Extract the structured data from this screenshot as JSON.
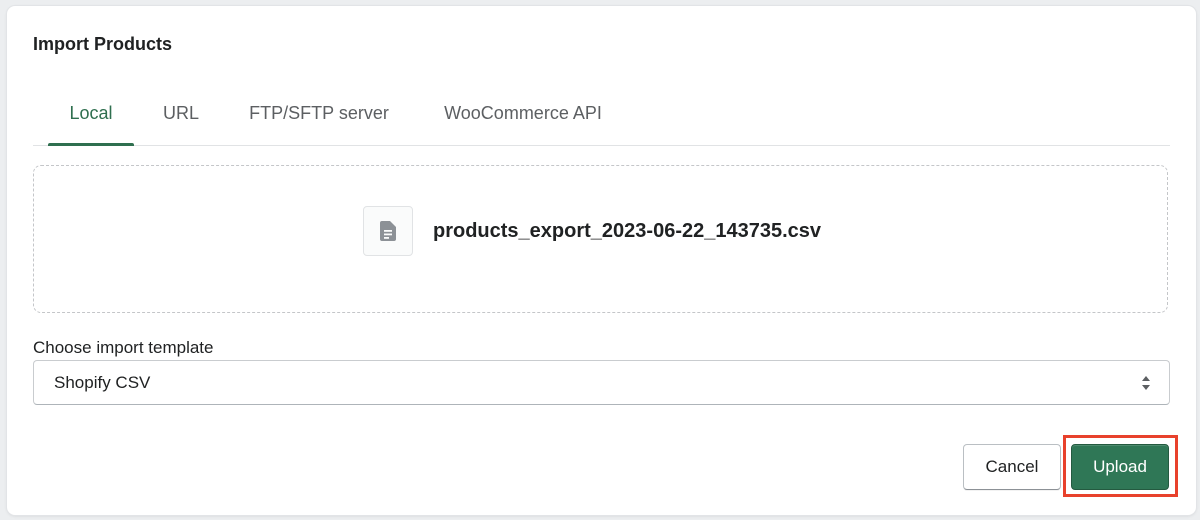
{
  "dialog": {
    "title": "Import Products"
  },
  "tabs": [
    {
      "label": "Local",
      "active": true
    },
    {
      "label": "URL",
      "active": false
    },
    {
      "label": "FTP/SFTP server",
      "active": false
    },
    {
      "label": "WooCommerce API",
      "active": false
    }
  ],
  "dropzone": {
    "file_icon": "document-icon",
    "file_name": "products_export_2023-06-22_143735.csv"
  },
  "template_select": {
    "label": "Choose import template",
    "value": "Shopify CSV",
    "icon": "select-arrows-icon"
  },
  "actions": {
    "cancel_label": "Cancel",
    "upload_label": "Upload"
  },
  "colors": {
    "accent": "#2f6f4f",
    "primary_button": "#2f7756",
    "highlight": "#e8412c"
  }
}
